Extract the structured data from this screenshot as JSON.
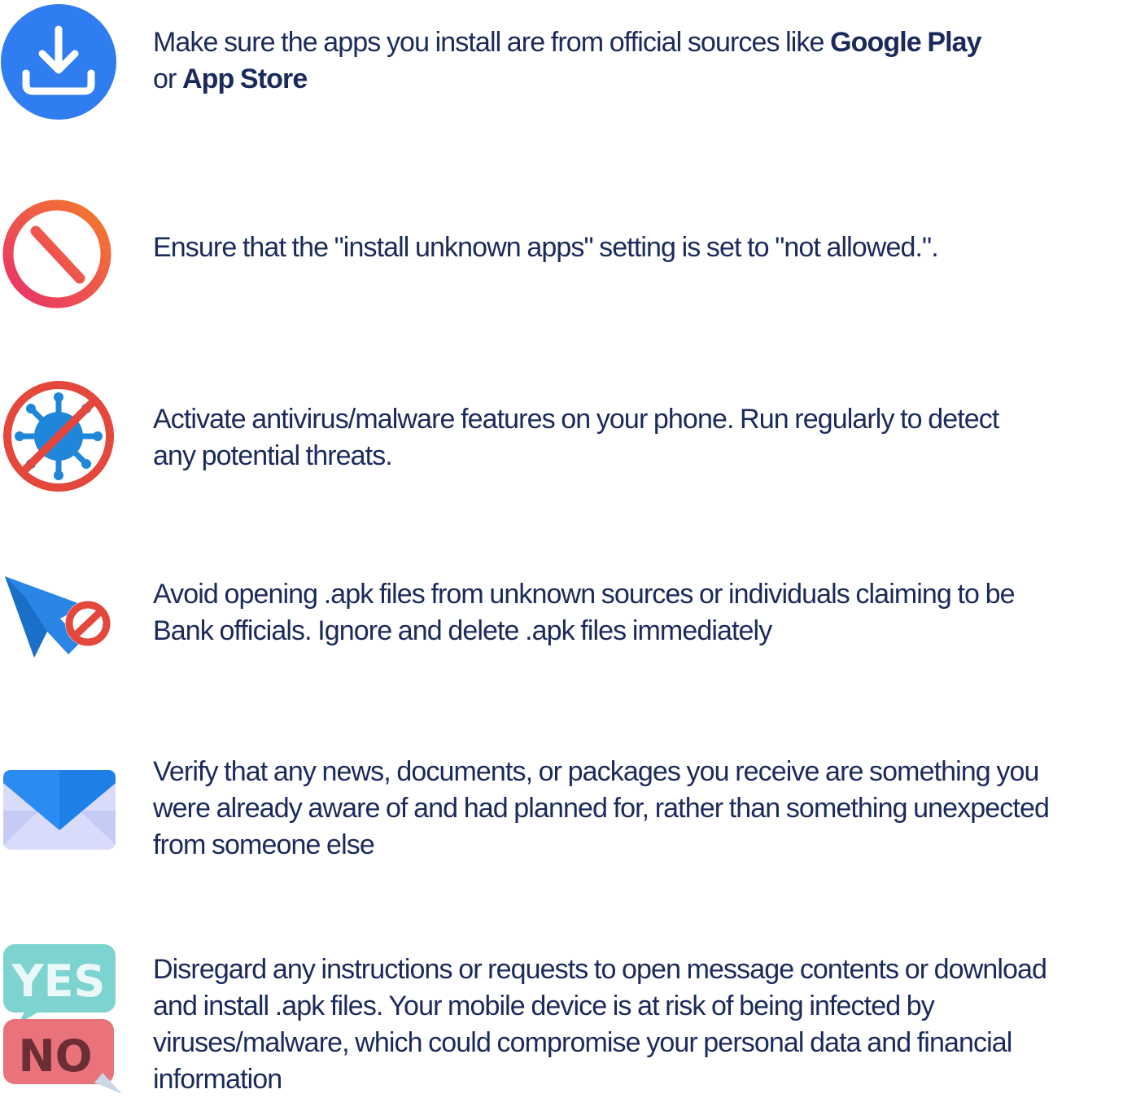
{
  "tips": [
    {
      "icon": "download-icon",
      "lines": [
        [
          "Make sure the apps you install are from official sources like ",
          "Google Play"
        ],
        [
          "or ",
          "App Store"
        ]
      ]
    },
    {
      "icon": "no-entry-icon",
      "lines": [
        "Ensure that the \"install unknown apps\" setting is set to \"not allowed.\"."
      ]
    },
    {
      "icon": "no-virus-icon",
      "lines": [
        "Activate antivirus/malware features on your phone. Run regularly to detect",
        "any potential threats."
      ]
    },
    {
      "icon": "cursor-block-icon",
      "lines": [
        "Avoid opening .apk files from unknown sources or individuals claiming to be",
        "Bank officials. Ignore and delete .apk files immediately"
      ]
    },
    {
      "icon": "envelope-icon",
      "lines": [
        "Verify that any news, documents, or packages you receive are something you",
        "were already aware of and had planned for, rather than something unexpected",
        "from someone else"
      ]
    },
    {
      "icon": "yes-no-icon",
      "icon_text": [
        "YES",
        "NO"
      ],
      "lines": [
        "Disregard any instructions or requests to open message contents or download",
        "and install .apk files. Your mobile device is at risk of being infected by",
        "viruses/malware, which could compromise your personal data and financial",
        "information"
      ]
    }
  ],
  "colors": {
    "text": "#1b2a5c",
    "download_blue": "#2f7df0",
    "no_entry_pink": "#e8326a",
    "no_entry_orange": "#f47b2c",
    "virus_red": "#e4473b",
    "virus_blue": "#1f86d9",
    "envelope_blue": "#2a8cf2",
    "envelope_light": "#d8dcfa",
    "yes_teal": "#7dd3cf",
    "no_red": "#e9727b"
  }
}
